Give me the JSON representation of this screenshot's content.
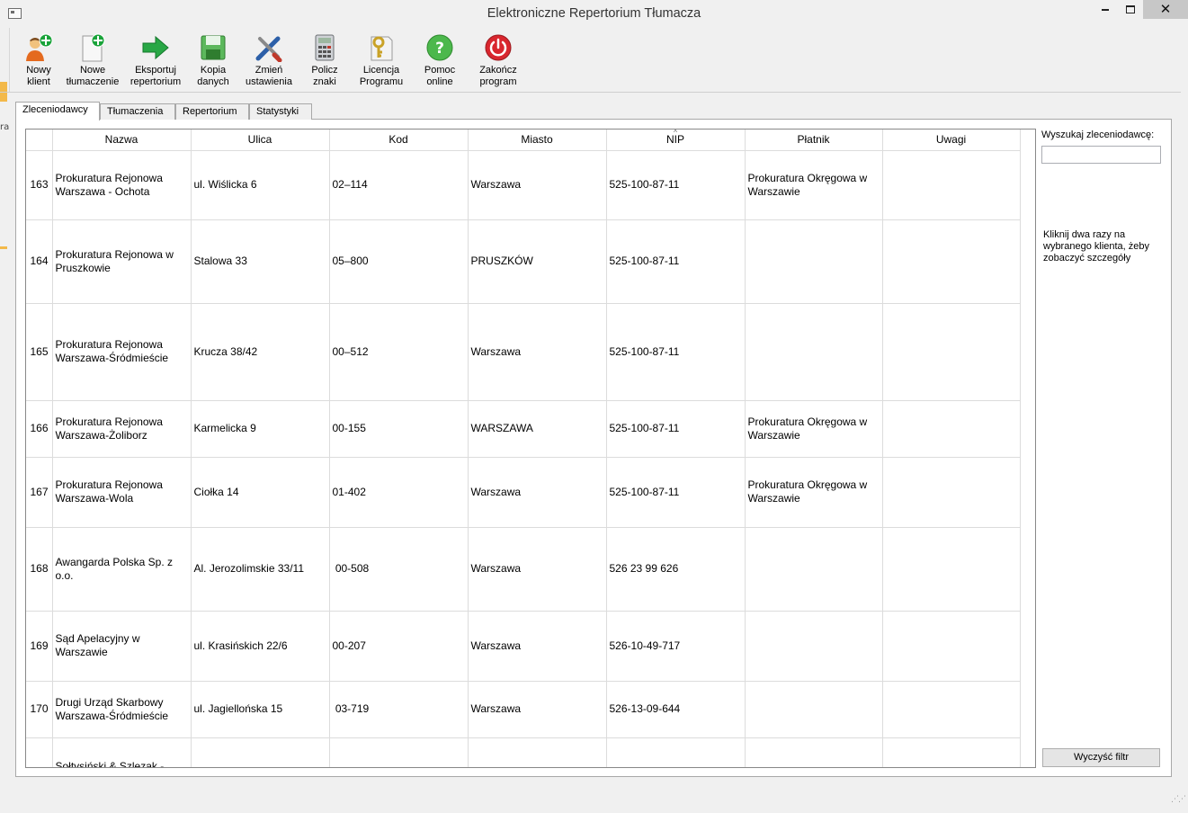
{
  "window": {
    "title": "Elektroniczne Repertorium Tłumacza"
  },
  "toolbar": {
    "items": [
      {
        "label": "Nowy\nklient",
        "icon": "add-user-icon"
      },
      {
        "label": "Nowe\ntłumaczenie",
        "icon": "new-document-icon"
      },
      {
        "label": "Eksportuj\nrepertorium",
        "icon": "export-arrow-icon"
      },
      {
        "label": "Kopia\ndanych",
        "icon": "floppy-disk-icon"
      },
      {
        "label": "Zmień\nustawienia",
        "icon": "tools-icon"
      },
      {
        "label": "Policz\nznaki",
        "icon": "calculator-icon"
      },
      {
        "label": "Licencja\nProgramu",
        "icon": "license-key-icon"
      },
      {
        "label": "Pomoc\nonline",
        "icon": "help-icon"
      },
      {
        "label": "Zakończ\nprogram",
        "icon": "power-icon"
      }
    ]
  },
  "tabs": [
    {
      "label": "Zleceniodawcy",
      "active": true
    },
    {
      "label": "Tłumaczenia",
      "active": false
    },
    {
      "label": "Repertorium",
      "active": false
    },
    {
      "label": "Statystyki",
      "active": false
    }
  ],
  "grid": {
    "columns": [
      "Nazwa",
      "Ulica",
      "Kod",
      "Miasto",
      "NIP",
      "Płatnik",
      "Uwagi"
    ],
    "sorted_column": "NIP",
    "rows": [
      {
        "no": "163",
        "nazwa": "Prokuratura Rejonowa Warszawa - Ochota",
        "ulica": "ul. Wiślicka 6",
        "kod": "02–114",
        "miasto": "Warszawa",
        "nip": "525-100-87-11",
        "platnik": "Prokuratura Okręgowa w Warszawie",
        "uwagi": ""
      },
      {
        "no": "164",
        "nazwa": "Prokuratura Rejonowa w Pruszkowie",
        "ulica": "Stalowa 33",
        "kod": "05–800",
        "miasto": "PRUSZKÓW",
        "nip": "525-100-87-11",
        "platnik": "",
        "uwagi": ""
      },
      {
        "no": "165",
        "nazwa": "Prokuratura Rejonowa Warszawa-Śródmieście",
        "ulica": "Krucza 38/42",
        "kod": "00–512",
        "miasto": "Warszawa",
        "nip": "525-100-87-11",
        "platnik": "",
        "uwagi": ""
      },
      {
        "no": "166",
        "nazwa": "Prokuratura Rejonowa Warszawa-Żoliborz",
        "ulica": "Karmelicka 9",
        "kod": "00-155",
        "miasto": "WARSZAWA",
        "nip": "525-100-87-11",
        "platnik": "Prokuratura Okręgowa w Warszawie",
        "uwagi": ""
      },
      {
        "no": "167",
        "nazwa": "Prokuratura Rejonowa Warszawa-Wola",
        "ulica": "Ciołka 14",
        "kod": "01-402",
        "miasto": "Warszawa",
        "nip": "525-100-87-11",
        "platnik": "Prokuratura Okręgowa w Warszawie",
        "uwagi": ""
      },
      {
        "no": "168",
        "nazwa": "Awangarda Polska Sp. z o.o.",
        "ulica": "Al. Jerozolimskie 33/11",
        "kod": " 00-508",
        "miasto": "Warszawa",
        "nip": "526 23 99 626",
        "platnik": "",
        "uwagi": ""
      },
      {
        "no": "169",
        "nazwa": "Sąd Apelacyjny w Warszawie",
        "ulica": "ul. Krasińskich 22/6",
        "kod": "00-207",
        "miasto": "Warszawa",
        "nip": "526-10-49-717",
        "platnik": "",
        "uwagi": ""
      },
      {
        "no": "170",
        "nazwa": "Drugi Urząd Skarbowy Warszawa-Śródmieście",
        "ulica": "ul. Jagiellońska 15",
        "kod": " 03-719",
        "miasto": "Warszawa",
        "nip": "526-13-09-644",
        "platnik": "",
        "uwagi": ""
      },
      {
        "no": "",
        "nazwa": "Sołtysiński & Szlezak -",
        "ulica": "",
        "kod": "",
        "miasto": "",
        "nip": "",
        "platnik": "",
        "uwagi": ""
      }
    ]
  },
  "search": {
    "label": "Wyszukaj zleceniodawcę:",
    "value": ""
  },
  "hint": "Kliknij dwa razy na wybranego klienta, żeby zobaczyć szczegóły",
  "clear_button": "Wyczyść filtr",
  "left_edge_text": "ra"
}
